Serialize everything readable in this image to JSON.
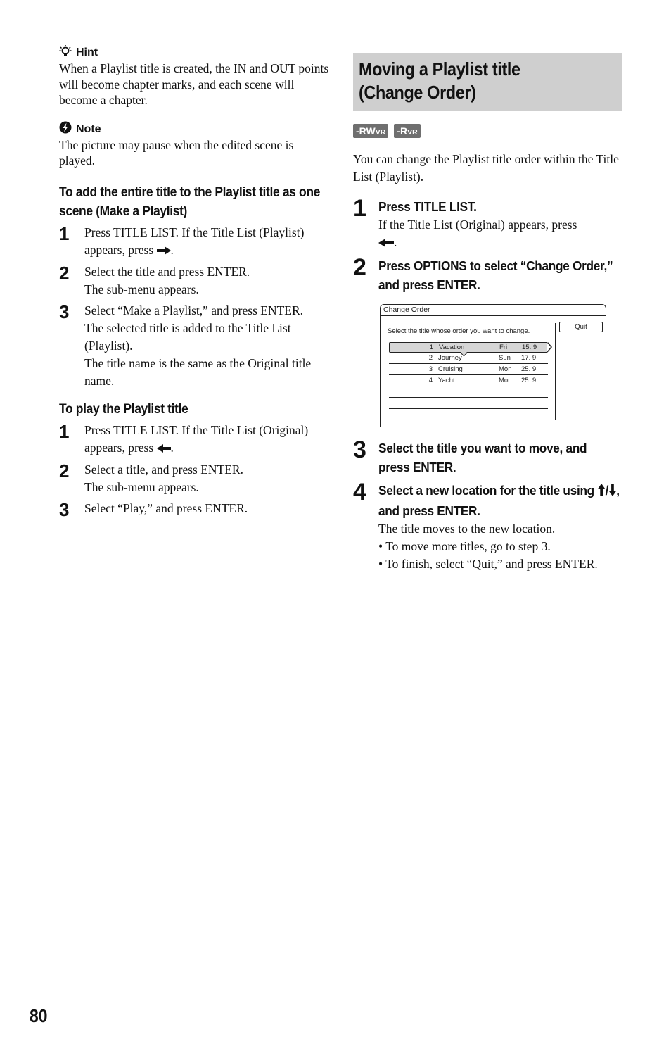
{
  "page_number": "80",
  "left": {
    "hint": {
      "icon": "lightbulb-icon",
      "label": "Hint",
      "text": "When a Playlist title is created, the IN and OUT points will become chapter marks, and each scene will become a chapter."
    },
    "note": {
      "icon": "note-icon",
      "label": "Note",
      "text": "The picture may pause when the edited scene is played."
    },
    "make_playlist": {
      "heading": "To add the entire title to the Playlist title as one scene (Make a Playlist)",
      "steps": [
        {
          "num": "1",
          "lines": [
            "Press TITLE LIST. If the Title List (Playlist) appears, press"
          ],
          "trail_icon": "right-arrow-icon",
          "trail": "."
        },
        {
          "num": "2",
          "lines": [
            "Select the title and press ENTER.",
            "The sub-menu appears."
          ]
        },
        {
          "num": "3",
          "lines": [
            "Select “Make a Playlist,” and press ENTER.",
            "The selected title is added to the Title List (Playlist).",
            "The title name is the same as the Original title name."
          ]
        }
      ]
    },
    "play_playlist": {
      "heading": "To play the Playlist title",
      "steps": [
        {
          "num": "1",
          "lines": [
            "Press TITLE LIST. If the Title List (Original) appears, press"
          ],
          "trail_icon": "left-arrow-icon",
          "trail": "."
        },
        {
          "num": "2",
          "lines": [
            "Select a title, and press ENTER.",
            "The sub-menu appears."
          ]
        },
        {
          "num": "3",
          "lines": [
            "Select “Play,” and press ENTER."
          ]
        }
      ]
    }
  },
  "right": {
    "section_title": [
      "Moving a Playlist title",
      "(Change Order)"
    ],
    "badges": [
      {
        "main": "-RW",
        "suffix": "VR"
      },
      {
        "main": "-R",
        "suffix": "VR"
      }
    ],
    "intro": "You can change the Playlist title order within the Title List (Playlist).",
    "steps": [
      {
        "num": "1",
        "head": "Press TITLE LIST.",
        "body": "If the Title List (Original) appears, press",
        "trail_icon": "left-arrow-icon",
        "trail": "."
      },
      {
        "num": "2",
        "head": "Press OPTIONS to select “Change Order,” and press ENTER."
      },
      {
        "num": "3",
        "head": "Select the title you want to move, and press ENTER."
      },
      {
        "num": "4",
        "head_pre": "Select a new location for the title using",
        "head_icons": [
          "up-arrow-icon",
          "down-arrow-icon"
        ],
        "head_post": ", and press ENTER.",
        "body": "The title moves to the new location.",
        "bullets": [
          "To move more titles, go to step 3.",
          "To finish, select “Quit,” and press ENTER."
        ]
      }
    ],
    "screen": {
      "title": "Change Order",
      "instruction": "Select the title whose order you want to change.",
      "quit_label": "Quit",
      "rows": [
        {
          "num": "1",
          "name": "Vacation",
          "day": "Fri",
          "date": "15. 9",
          "selected": true
        },
        {
          "num": "2",
          "name": "Journey",
          "day": "Sun",
          "date": "17. 9"
        },
        {
          "num": "3",
          "name": "Cruising",
          "day": "Mon",
          "date": "25. 9"
        },
        {
          "num": "4",
          "name": "Yacht",
          "day": "Mon",
          "date": "25. 9"
        },
        {
          "num": "",
          "name": "",
          "day": "",
          "date": ""
        },
        {
          "num": "",
          "name": "",
          "day": "",
          "date": ""
        },
        {
          "num": "",
          "name": "",
          "day": "",
          "date": ""
        }
      ]
    }
  }
}
